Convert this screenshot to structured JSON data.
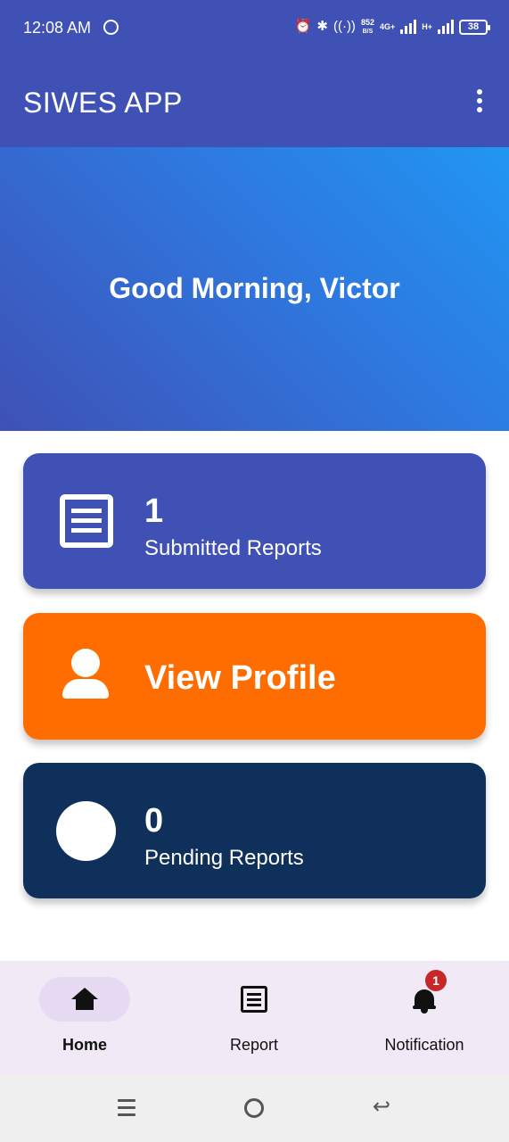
{
  "status_bar": {
    "time": "12:08 AM",
    "net_speed_value": "852",
    "net_speed_unit": "B/S",
    "network_1": "4G+",
    "network_2": "H+",
    "battery": "38"
  },
  "app_bar": {
    "title": "SIWES APP"
  },
  "banner": {
    "greeting": "Good Morning, Victor"
  },
  "cards": {
    "submitted": {
      "count": "1",
      "label": "Submitted Reports"
    },
    "profile": {
      "label": "View Profile"
    },
    "pending": {
      "count": "0",
      "label": "Pending Reports"
    }
  },
  "bottom_nav": {
    "home": "Home",
    "report": "Report",
    "notification": "Notification",
    "notification_badge": "1"
  },
  "colors": {
    "primary": "#3f51b5",
    "gradient_end": "#2196f3",
    "profile_card": "#ff6d00",
    "pending_card": "#0f305b",
    "nav_bg": "#f1e9f5",
    "badge": "#c62828"
  }
}
